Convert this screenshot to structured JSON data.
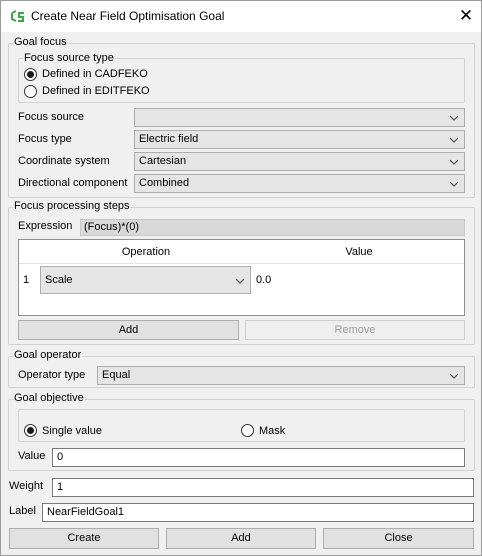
{
  "window": {
    "title": "Create Near Field Optimisation Goal",
    "close_glyph": "✕"
  },
  "goal_focus": {
    "group_title": "Goal focus",
    "source_type": {
      "group_title": "Focus source type",
      "options": [
        "Defined in CADFEKO",
        "Defined in EDITFEKO"
      ],
      "selected": "Defined in CADFEKO"
    },
    "focus_source": {
      "label": "Focus source",
      "value": ""
    },
    "focus_type": {
      "label": "Focus type",
      "value": "Electric field"
    },
    "coordinate_system": {
      "label": "Coordinate system",
      "value": "Cartesian"
    },
    "directional_component": {
      "label": "Directional component",
      "value": "Combined"
    }
  },
  "processing": {
    "group_title": "Focus processing steps",
    "expression_label": "Expression",
    "expression_value": "(Focus)*(0)",
    "table": {
      "columns": [
        "Operation",
        "Value"
      ],
      "rows": [
        {
          "index": "1",
          "operation": "Scale",
          "value": "0.0"
        }
      ]
    },
    "add_label": "Add",
    "remove_label": "Remove"
  },
  "operator": {
    "group_title": "Goal operator",
    "label": "Operator type",
    "value": "Equal"
  },
  "objective": {
    "group_title": "Goal objective",
    "options": [
      "Single value",
      "Mask"
    ],
    "selected": "Single value",
    "value_label": "Value",
    "value": "0"
  },
  "weight": {
    "label": "Weight",
    "value": "1"
  },
  "name": {
    "label": "Label",
    "value": "NearFieldGoal1"
  },
  "footer": {
    "create_label": "Create",
    "add_label": "Add",
    "close_label": "Close"
  },
  "icons": {
    "app": "feko-app-icon",
    "dropdown": "chevron-down-icon",
    "close": "close-icon"
  },
  "colors": {
    "app_icon_green": "#3aa648",
    "window_bg": "#f0f0f0",
    "combo_bg": "#e5e5e5",
    "readonly_bg": "#d9d9d9"
  }
}
